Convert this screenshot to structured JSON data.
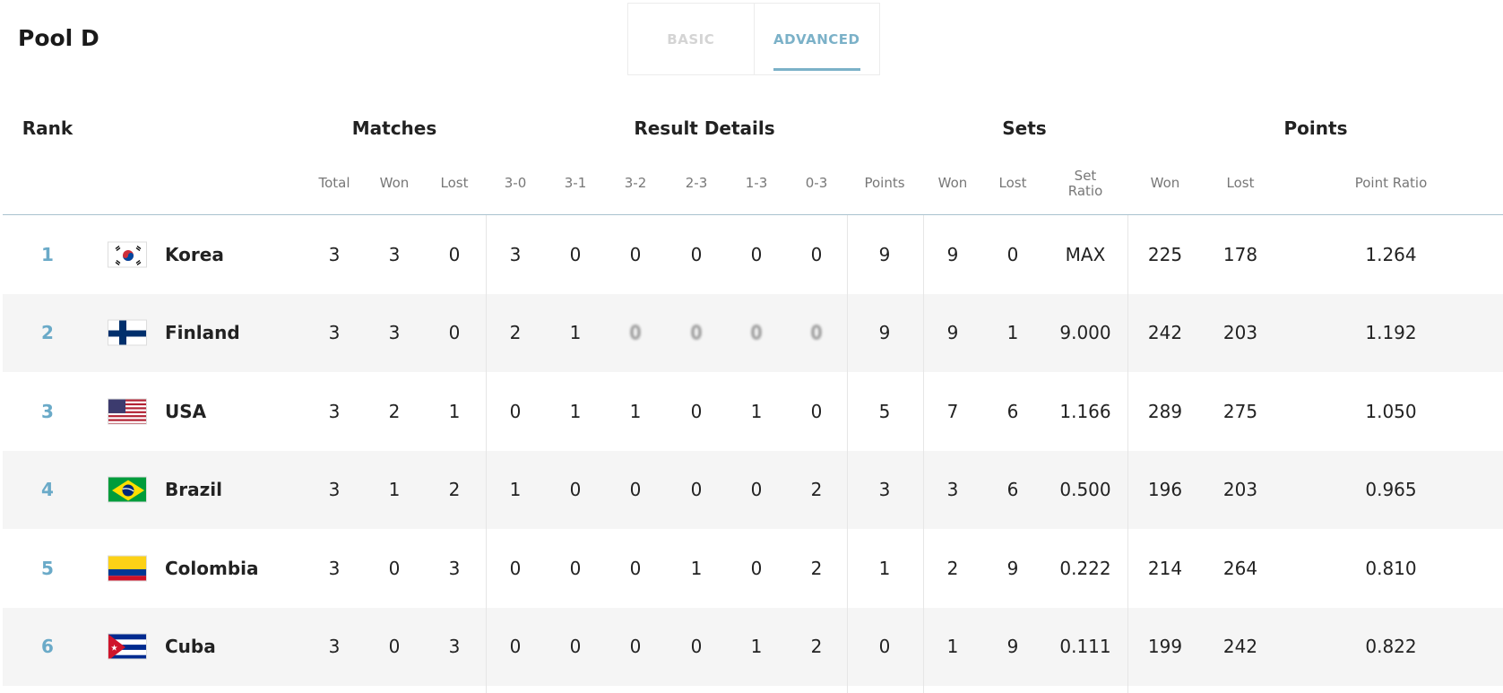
{
  "pool_title": "Pool D",
  "tabs": [
    {
      "label": "BASIC",
      "active": false
    },
    {
      "label": "ADVANCED",
      "active": true
    }
  ],
  "group_headers": {
    "rank": "Rank",
    "matches": "Matches",
    "result_details": "Result Details",
    "sets": "Sets",
    "points": "Points"
  },
  "columns": {
    "matches_total": "Total",
    "matches_won": "Won",
    "matches_lost": "Lost",
    "r30": "3-0",
    "r31": "3-1",
    "r32": "3-2",
    "r23": "2-3",
    "r13": "1-3",
    "r03": "0-3",
    "result_points": "Points",
    "sets_won": "Won",
    "sets_lost": "Lost",
    "set_ratio_line1": "Set",
    "set_ratio_line2": "Ratio",
    "points_won": "Won",
    "points_lost": "Lost",
    "point_ratio": "Point Ratio"
  },
  "accent_color": "#6aaac8",
  "rows": [
    {
      "rank": "1",
      "country": "Korea",
      "flag": "korea-flag-icon",
      "total": "3",
      "won": "3",
      "lost": "0",
      "r30": "3",
      "r31": "0",
      "r32": "0",
      "r23": "0",
      "r13": "0",
      "r03": "0",
      "points": "9",
      "sets_won": "9",
      "sets_lost": "0",
      "set_ratio": "MAX",
      "pts_won": "225",
      "pts_lost": "178",
      "point_ratio": "1.264"
    },
    {
      "rank": "2",
      "country": "Finland",
      "flag": "finland-flag-icon",
      "total": "3",
      "won": "3",
      "lost": "0",
      "r30": "2",
      "r31": "1",
      "r32": "0",
      "r23": "0",
      "r13": "0",
      "r03": "0",
      "points": "9",
      "sets_won": "9",
      "sets_lost": "1",
      "set_ratio": "9.000",
      "pts_won": "242",
      "pts_lost": "203",
      "point_ratio": "1.192"
    },
    {
      "rank": "3",
      "country": "USA",
      "flag": "usa-flag-icon",
      "total": "3",
      "won": "2",
      "lost": "1",
      "r30": "0",
      "r31": "1",
      "r32": "1",
      "r23": "0",
      "r13": "1",
      "r03": "0",
      "points": "5",
      "sets_won": "7",
      "sets_lost": "6",
      "set_ratio": "1.166",
      "pts_won": "289",
      "pts_lost": "275",
      "point_ratio": "1.050"
    },
    {
      "rank": "4",
      "country": "Brazil",
      "flag": "brazil-flag-icon",
      "total": "3",
      "won": "1",
      "lost": "2",
      "r30": "1",
      "r31": "0",
      "r32": "0",
      "r23": "0",
      "r13": "0",
      "r03": "2",
      "points": "3",
      "sets_won": "3",
      "sets_lost": "6",
      "set_ratio": "0.500",
      "pts_won": "196",
      "pts_lost": "203",
      "point_ratio": "0.965"
    },
    {
      "rank": "5",
      "country": "Colombia",
      "flag": "colombia-flag-icon",
      "total": "3",
      "won": "0",
      "lost": "3",
      "r30": "0",
      "r31": "0",
      "r32": "0",
      "r23": "1",
      "r13": "0",
      "r03": "2",
      "points": "1",
      "sets_won": "2",
      "sets_lost": "9",
      "set_ratio": "0.222",
      "pts_won": "214",
      "pts_lost": "264",
      "point_ratio": "0.810"
    },
    {
      "rank": "6",
      "country": "Cuba",
      "flag": "cuba-flag-icon",
      "total": "3",
      "won": "0",
      "lost": "3",
      "r30": "0",
      "r31": "0",
      "r32": "0",
      "r23": "0",
      "r13": "1",
      "r03": "2",
      "points": "0",
      "sets_won": "1",
      "sets_lost": "9",
      "set_ratio": "0.111",
      "pts_won": "199",
      "pts_lost": "242",
      "point_ratio": "0.822"
    }
  ]
}
